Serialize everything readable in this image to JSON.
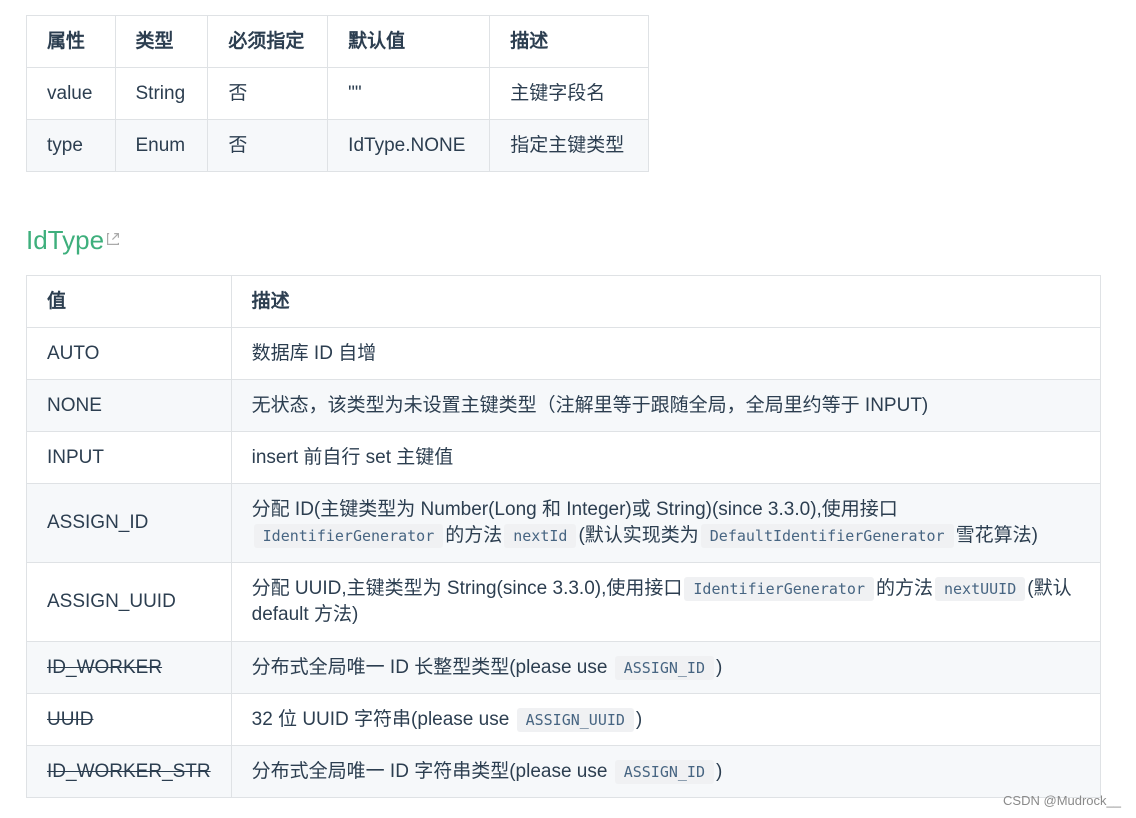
{
  "attr_table": {
    "headers": [
      "属性",
      "类型",
      "必须指定",
      "默认值",
      "描述"
    ],
    "rows": [
      [
        "value",
        "String",
        "否",
        "\"\"",
        "主键字段名"
      ],
      [
        "type",
        "Enum",
        "否",
        "IdType.NONE",
        "指定主键类型"
      ]
    ]
  },
  "idtype_heading": "IdType",
  "idtype_table": {
    "headers": [
      "值",
      "描述"
    ],
    "rows": {
      "auto": {
        "value": "AUTO",
        "desc": "数据库 ID 自增"
      },
      "none": {
        "value": "NONE",
        "desc": "无状态，该类型为未设置主键类型（注解里等于跟随全局，全局里约等于 INPUT)"
      },
      "input": {
        "value": "INPUT",
        "desc": "insert 前自行 set 主键值"
      },
      "assign_id": {
        "value": "ASSIGN_ID",
        "desc_1": "分配 ID(主键类型为 Number(Long 和 Integer)或 String)(since 3.3.0),使用接口",
        "code_1": "IdentifierGenerator",
        "desc_2": "的方法",
        "code_2": "nextId",
        "desc_3": "(默认实现类为",
        "code_3": "DefaultIdentifierGenerator",
        "desc_4": "雪花算法)"
      },
      "assign_uuid": {
        "value": "ASSIGN_UUID",
        "desc_1": "分配 UUID,主键类型为 String(since 3.3.0),使用接口",
        "code_1": "IdentifierGenerator",
        "desc_2": "的方法",
        "code_2": "nextUUID",
        "desc_3": "(默认 default 方法)"
      },
      "id_worker": {
        "value": "ID_WORKER",
        "desc_1": "分布式全局唯一 ID 长整型类型(please use",
        "code_1": "ASSIGN_ID",
        "desc_2": ")"
      },
      "uuid": {
        "value": "UUID",
        "desc_1": "32 位 UUID 字符串(please use",
        "code_1": "ASSIGN_UUID",
        "desc_2": ")"
      },
      "id_worker_str": {
        "value": "ID_WORKER_STR",
        "desc_1": "分布式全局唯一 ID 字符串类型(please use",
        "code_1": "ASSIGN_ID",
        "desc_2": ")"
      }
    }
  },
  "watermark": "CSDN @Mudrock__"
}
